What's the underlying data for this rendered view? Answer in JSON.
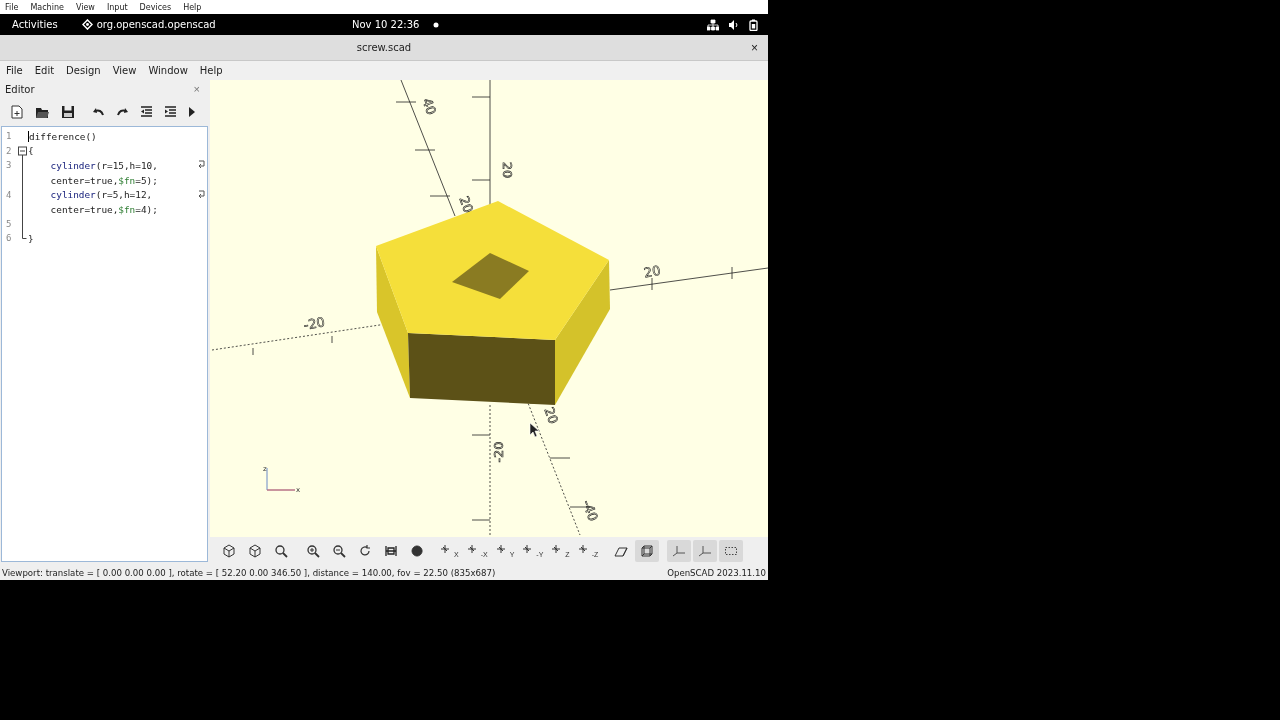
{
  "host_menu": [
    "File",
    "Machine",
    "View",
    "Input",
    "Devices",
    "Help"
  ],
  "top_bar": {
    "activities": "Activities",
    "app": "org.openscad.openscad",
    "clock": "Nov 10  22:36"
  },
  "window": {
    "title": "screw.scad",
    "close": "×"
  },
  "menu": [
    "File",
    "Edit",
    "Design",
    "View",
    "Window",
    "Help"
  ],
  "editor": {
    "title": "Editor",
    "close": "×",
    "lines": [
      {
        "number": "1",
        "cursor": true,
        "tokens": [
          {
            "kind": "plain",
            "text": "difference()"
          }
        ]
      },
      {
        "number": "2",
        "expanded": true,
        "tokens": [
          {
            "kind": "plain",
            "text": "{"
          }
        ]
      },
      {
        "number": "3",
        "indented": true,
        "tokens": [
          {
            "kind": "module",
            "text": "cylinder"
          },
          {
            "kind": "plain",
            "text": "(r=15,h=10,"
          }
        ],
        "wrap": [
          {
            "kind": "plain",
            "text": "center=true,"
          },
          {
            "kind": "special",
            "text": "$fn"
          },
          {
            "kind": "plain",
            "text": "=5);"
          }
        ]
      },
      {
        "number": "4",
        "indented": true,
        "tokens": [
          {
            "kind": "module",
            "text": "cylinder"
          },
          {
            "kind": "plain",
            "text": "(r=5,h=12,"
          }
        ],
        "wrap": [
          {
            "kind": "plain",
            "text": "center=true,"
          },
          {
            "kind": "special",
            "text": "$fn"
          },
          {
            "kind": "plain",
            "text": "=4);"
          }
        ]
      },
      {
        "number": "5"
      },
      {
        "number": "6",
        "fold_end": true,
        "tokens": [
          {
            "kind": "plain",
            "text": "}"
          }
        ]
      }
    ]
  },
  "viewport": {
    "axis_labels": [
      "40",
      "20",
      "20",
      "20",
      "-20",
      "20",
      "-20",
      "-40"
    ],
    "indicator": [
      "z",
      "x"
    ]
  },
  "viewer_toolbar": [
    {
      "selected": false
    },
    {
      "selected": false
    },
    {
      "selected": false
    },
    {
      "selected": false
    },
    {
      "selected": false
    },
    {
      "selected": false
    },
    {
      "selected": false
    },
    {
      "selected": false
    },
    {
      "selected": false,
      "label": "X"
    },
    {
      "selected": false,
      "label": "-X"
    },
    {
      "selected": false,
      "label": "Y"
    },
    {
      "selected": false,
      "label": "-Y"
    },
    {
      "selected": false,
      "label": "Z"
    },
    {
      "selected": false,
      "label": "-Z"
    },
    {
      "selected": false
    },
    {
      "selected": true
    },
    {
      "selected": true
    },
    {
      "selected": true
    },
    {
      "selected": true
    }
  ],
  "status_bar": {
    "viewport": "Viewport: translate = [ 0.00 0.00 0.00 ], rotate = [ 52.20 0.00 346.50 ], distance = 140.00, fov = 22.50 (835x687)",
    "version": "OpenSCAD 2023.11.10"
  }
}
